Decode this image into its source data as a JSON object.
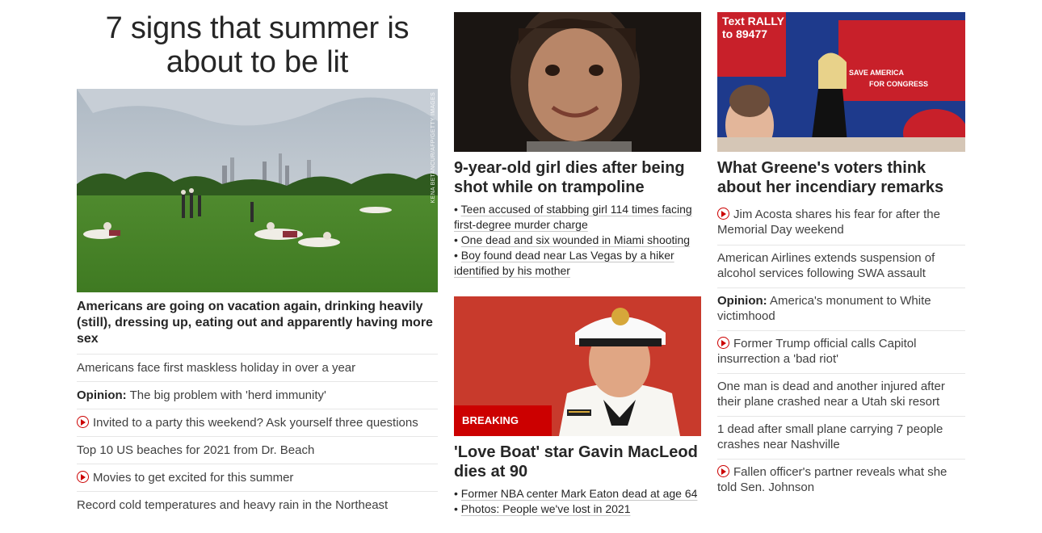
{
  "left": {
    "title": "7 signs that summer is about to be lit",
    "image": {
      "alt": "People relaxing on a lawn in Central Park",
      "credit": "KENA BETANCUR/AFP/GETTY IMAGES"
    },
    "lead_headline": "Americans are going on vacation again, drinking heavily (still), dressing up, eating out and apparently having more sex",
    "items": [
      {
        "text": "Americans face first maskless holiday in over a year",
        "prefix": "",
        "video": false
      },
      {
        "text": "The big problem with 'herd immunity'",
        "prefix": "Opinion:",
        "video": false
      },
      {
        "text": "Invited to a party this weekend? Ask yourself three questions",
        "prefix": "",
        "video": true
      },
      {
        "text": "Top 10 US beaches for 2021 from Dr. Beach",
        "prefix": "",
        "video": false
      },
      {
        "text": "Movies to get excited for this summer",
        "prefix": "",
        "video": true
      },
      {
        "text": "Record cold temperatures and heavy rain in the Northeast",
        "prefix": "",
        "video": false
      }
    ]
  },
  "middle": {
    "card1": {
      "image_alt": "Smiling young girl",
      "headline": "9-year-old girl dies after being shot while on trampoline",
      "bullets": [
        "Teen accused of stabbing girl 114 times facing first-degree murder charge",
        "One dead and six wounded in Miami shooting",
        "Boy found dead near Las Vegas by a hiker identified by his mother"
      ]
    },
    "card2": {
      "image_alt": "Gavin MacLeod in captain uniform",
      "badge": "BREAKING NEWS",
      "headline": "'Love Boat' star Gavin MacLeod dies at 90",
      "bullets": [
        "Former NBA center Mark Eaton dead at age 64",
        "Photos: People we've lost in 2021"
      ]
    }
  },
  "right": {
    "image_alt": "Marjorie Taylor Greene at a rally",
    "image_sign_text": [
      "Text RALLY",
      "to 89477",
      "SAVE AMERICA",
      "FOR CONGRESS"
    ],
    "headline": "What Greene's voters think about her incendiary remarks",
    "items": [
      {
        "text": "Jim Acosta shares his fear for after the Memorial Day weekend",
        "prefix": "",
        "video": true
      },
      {
        "text": "American Airlines extends suspension of alcohol services following SWA assault",
        "prefix": "",
        "video": false
      },
      {
        "text": "America's monument to White victimhood",
        "prefix": "Opinion:",
        "video": false
      },
      {
        "text": "Former Trump official calls Capitol insurrection a 'bad riot'",
        "prefix": "",
        "video": true
      },
      {
        "text": "One man is dead and another injured after their plane crashed near a Utah ski resort",
        "prefix": "",
        "video": false
      },
      {
        "text": "1 dead after small plane carrying 7 people crashes near Nashville",
        "prefix": "",
        "video": false
      },
      {
        "text": "Fallen officer's partner reveals what she told Sen. Johnson",
        "prefix": "",
        "video": true
      }
    ]
  },
  "colors": {
    "accent_red": "#cc0000",
    "text": "#262626",
    "divider": "#e6e6e6"
  }
}
